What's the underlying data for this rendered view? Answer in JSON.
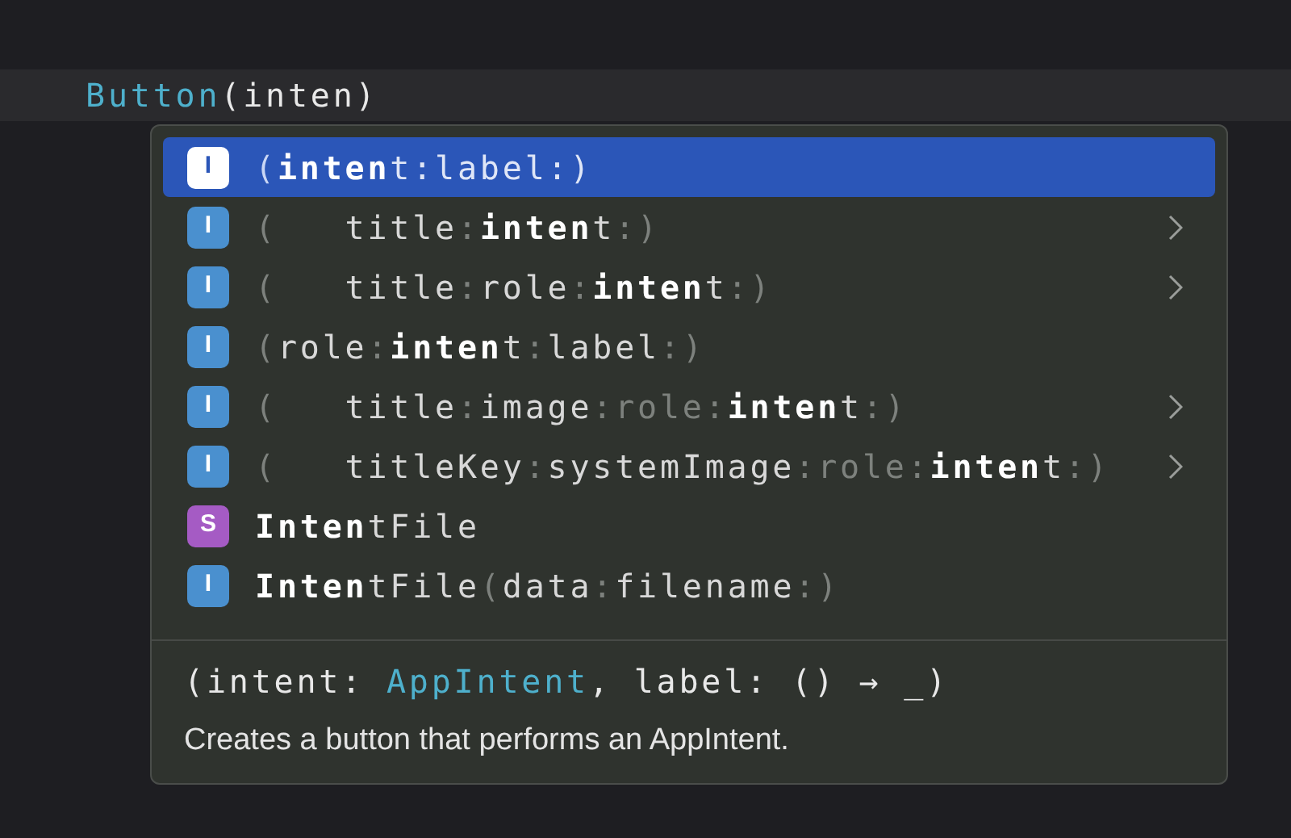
{
  "editor": {
    "code_line": [
      {
        "text": "Button",
        "kind": "type"
      },
      {
        "text": "(inten)",
        "kind": "plain"
      }
    ]
  },
  "completions": [
    {
      "badge": "I",
      "kind": "initializer",
      "selected": true,
      "submenu": false,
      "parts": [
        {
          "text": "(",
          "kind": "dim"
        },
        {
          "text": "inten",
          "kind": "match"
        },
        {
          "text": "t:label:)",
          "kind": "plain"
        }
      ]
    },
    {
      "badge": "I",
      "kind": "initializer",
      "selected": false,
      "submenu": true,
      "parts": [
        {
          "text": "(",
          "kind": "dim"
        },
        {
          "text": "   title",
          "kind": "plain"
        },
        {
          "text": ":",
          "kind": "dim"
        },
        {
          "text": "inten",
          "kind": "match"
        },
        {
          "text": "t",
          "kind": "plain"
        },
        {
          "text": ":)",
          "kind": "dim"
        }
      ]
    },
    {
      "badge": "I",
      "kind": "initializer",
      "selected": false,
      "submenu": true,
      "parts": [
        {
          "text": "(",
          "kind": "dim"
        },
        {
          "text": "   title",
          "kind": "plain"
        },
        {
          "text": ":",
          "kind": "dim"
        },
        {
          "text": "role",
          "kind": "plain"
        },
        {
          "text": ":",
          "kind": "dim"
        },
        {
          "text": "inten",
          "kind": "match"
        },
        {
          "text": "t",
          "kind": "plain"
        },
        {
          "text": ":)",
          "kind": "dim"
        }
      ]
    },
    {
      "badge": "I",
      "kind": "initializer",
      "selected": false,
      "submenu": false,
      "parts": [
        {
          "text": "(",
          "kind": "dim"
        },
        {
          "text": "role",
          "kind": "plain"
        },
        {
          "text": ":",
          "kind": "dim"
        },
        {
          "text": "inten",
          "kind": "match"
        },
        {
          "text": "t",
          "kind": "plain"
        },
        {
          "text": ":",
          "kind": "dim"
        },
        {
          "text": "label",
          "kind": "plain"
        },
        {
          "text": ":)",
          "kind": "dim"
        }
      ]
    },
    {
      "badge": "I",
      "kind": "initializer",
      "selected": false,
      "submenu": true,
      "parts": [
        {
          "text": "(",
          "kind": "dim"
        },
        {
          "text": "   title",
          "kind": "plain"
        },
        {
          "text": ":",
          "kind": "dim"
        },
        {
          "text": "image",
          "kind": "plain"
        },
        {
          "text": ":role:",
          "kind": "dim"
        },
        {
          "text": "inten",
          "kind": "match"
        },
        {
          "text": "t",
          "kind": "plain"
        },
        {
          "text": ":)",
          "kind": "dim"
        }
      ]
    },
    {
      "badge": "I",
      "kind": "initializer",
      "selected": false,
      "submenu": true,
      "parts": [
        {
          "text": "(",
          "kind": "dim"
        },
        {
          "text": "   titleKey",
          "kind": "plain"
        },
        {
          "text": ":",
          "kind": "dim"
        },
        {
          "text": "systemImage",
          "kind": "plain"
        },
        {
          "text": ":role:",
          "kind": "dim"
        },
        {
          "text": "inten",
          "kind": "match"
        },
        {
          "text": "t",
          "kind": "plain"
        },
        {
          "text": ":)",
          "kind": "dim"
        }
      ]
    },
    {
      "badge": "S",
      "kind": "struct",
      "selected": false,
      "submenu": false,
      "parts": [
        {
          "text": "Inten",
          "kind": "match"
        },
        {
          "text": "tFile",
          "kind": "plain"
        }
      ]
    },
    {
      "badge": "I",
      "kind": "initializer",
      "selected": false,
      "submenu": false,
      "parts": [
        {
          "text": "Inten",
          "kind": "match"
        },
        {
          "text": "tFile",
          "kind": "plain"
        },
        {
          "text": "(",
          "kind": "dim"
        },
        {
          "text": "data",
          "kind": "plain"
        },
        {
          "text": ":",
          "kind": "dim"
        },
        {
          "text": "filename",
          "kind": "plain"
        },
        {
          "text": ":)",
          "kind": "dim"
        }
      ]
    }
  ],
  "detail": {
    "signature": [
      {
        "text": "(intent: ",
        "kind": "plain"
      },
      {
        "text": "AppIntent",
        "kind": "type"
      },
      {
        "text": ", label: () → _)",
        "kind": "plain"
      }
    ],
    "description": "Creates a button that performs an AppIntent."
  }
}
